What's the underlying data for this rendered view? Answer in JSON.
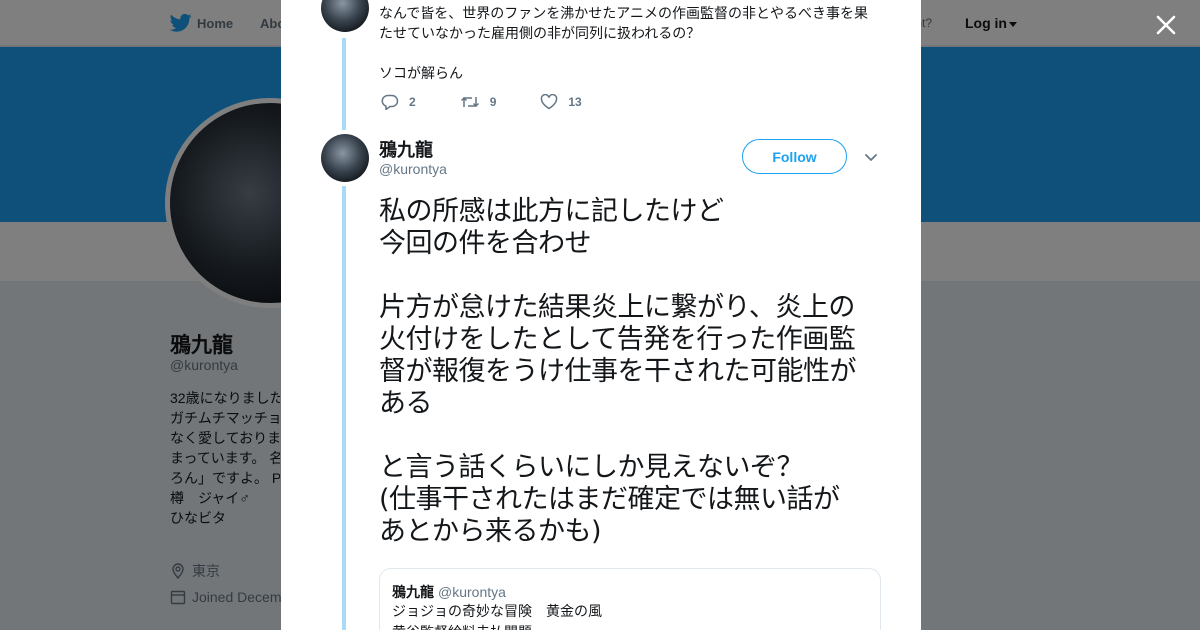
{
  "background": {
    "nav": {
      "home_label": "Home",
      "about_label": "Abo",
      "have_account": "ccount?",
      "login_label": "Log in"
    },
    "profile": {
      "name": "鴉九龍",
      "handle": "@kurontya",
      "bio_lines": [
        "32歳になりました",
        "ガチムチマッチョ",
        "なく愛しておりま",
        "まっています。 名",
        "ろん」ですよ。 P",
        "樽　ジャイ♂",
        "ひなビタ"
      ],
      "location": "東京",
      "joined": "Joined Decem"
    }
  },
  "modal": {
    "previous_tweet": {
      "lines": [
        "なんで皆を、世界のファンを沸かせたアニメの作画監督の非とやるべき事を果",
        "たせていなかった雇用側の非が同列に扱われるの？",
        "",
        "ソコが解らん"
      ],
      "reply_count": "2",
      "retweet_count": "9",
      "like_count": "13"
    },
    "tweet": {
      "name": "鴉九龍",
      "handle": "@kurontya",
      "follow_label": "Follow",
      "lines": [
        "私の所感は此方に記したけど",
        "今回の件を合わせ",
        "",
        "片方が怠けた結果炎上に繋がり、炎上の",
        "火付けをしたとして告発を行った作画監",
        "督が報復をうけ仕事を干された可能性が",
        "ある",
        "",
        "と言う話くらいにしか見えないぞ？",
        "(仕事干されたはまだ確定では無い話が",
        "あとから来るかも)"
      ]
    },
    "quoted_tweet": {
      "name": "鴉九龍",
      "handle": "@kurontya",
      "lines": [
        "ジョジョの奇妙な冒険　黄金の風",
        "黄谷監督給料未払問題"
      ]
    }
  }
}
